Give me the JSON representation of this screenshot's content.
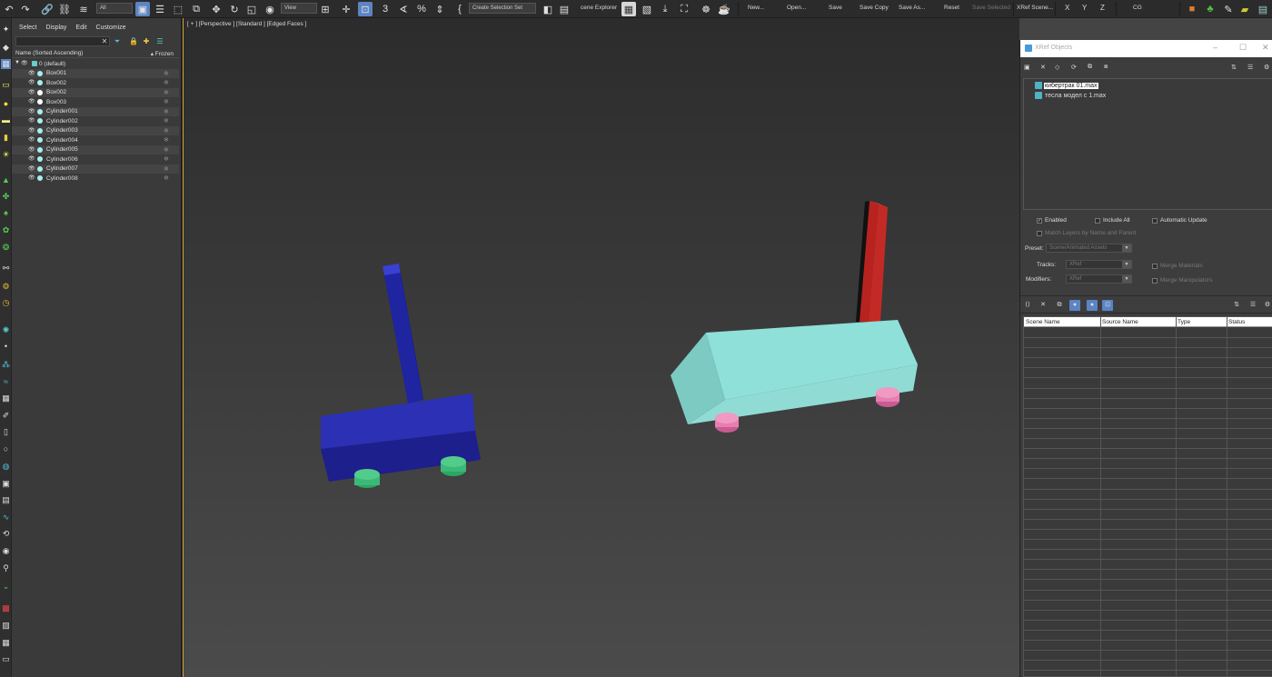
{
  "toolbar": {
    "filter_value": "All",
    "view_value": "View",
    "selection_set": "Create Selection Set",
    "scene_explorer": "cene Explorer",
    "new_label": "New...",
    "open_label": "Open...",
    "save_label": "Save",
    "save_copy_label": "Save Copy",
    "save_as_label": "Save As...",
    "reset_label": "Reset",
    "save_selected_label": "Save Selected",
    "xref_scene_label": "XRef Scene...",
    "x_label": "X",
    "y_label": "Y",
    "z_label": "Z",
    "cg_label": "CG"
  },
  "scene_explorer": {
    "menu": [
      "Select",
      "Display",
      "Edit",
      "Customize"
    ],
    "col_name": "Name (Sorted Ascending)",
    "col_frozen": "▴ Frozen",
    "root": "0 (default)",
    "objects": [
      "Box001",
      "Box002",
      "Box002",
      "Box003",
      "Cylinder001",
      "Cylinder002",
      "Cylinder003",
      "Cylinder004",
      "Cylinder005",
      "Cylinder006",
      "Cylinder007",
      "Cylinder008"
    ]
  },
  "viewport": {
    "label": "[ + ] [Perspective ] [Standard ] [Edged Faces ]"
  },
  "xref": {
    "title": "XRef Objects",
    "files": [
      "кибертрак 01.max",
      "тесла модел с 1.max"
    ],
    "enabled": "Enabled",
    "include_all": "Include All",
    "automatic_update": "Automatic Update",
    "match_layers": "Match Layers by Name and Parent",
    "preset_label": "Preset:",
    "preset_value": "Scene/Animated Assets",
    "tracks_label": "Tracks:",
    "tracks_value": "XRef",
    "modifiers_label": "Modifiers:",
    "modifiers_value": "XRef",
    "merge_materials": "Merge Materials",
    "merge_manipulators": "Merge Manipulators",
    "columns": [
      "Scene Name",
      "Source Name",
      "Type",
      "Status"
    ]
  },
  "colors": {
    "selection_blue": "#5b84c4",
    "viewport_border": "#d4a83a",
    "blue_model": "#2a2fb8",
    "cyan_model": "#8fe0d8",
    "red_mast": "#c42a25",
    "green_wheel": "#3cb878",
    "pink_wheel": "#e67fb0"
  }
}
